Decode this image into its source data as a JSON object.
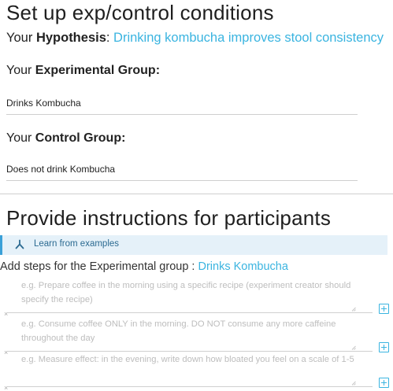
{
  "colors": {
    "accent": "#3ab4e0",
    "learn_bar_bg": "#e5f1f9",
    "learn_bar_border": "#3aa0d8"
  },
  "conditions": {
    "title": "Set up exp/control conditions",
    "hypothesis": {
      "prefix": "Your ",
      "label": "Hypothesis",
      "separator": ": ",
      "value": "Drinking kombucha improves stool consistency"
    },
    "experimental": {
      "prefix": "Your ",
      "label": "Experimental Group:",
      "value": "Drinks Kombucha"
    },
    "control": {
      "prefix": "Your ",
      "label": "Control Group:",
      "value": "Does not drink Kombucha"
    }
  },
  "instructions": {
    "title": "Provide instructions for participants",
    "learn": {
      "icon": "branch-icon",
      "label": "Learn from examples"
    },
    "steps_label": "Add steps for the Experimental group : ",
    "steps_group": "Drinks Kombucha",
    "steps": [
      {
        "placeholder": "e.g. Prepare coffee in the morning using a specific recipe (experiment creator should specify the recipe)",
        "remove_icon": "×",
        "add_icon": "plus-square-icon"
      },
      {
        "placeholder": "e.g. Consume coffee ONLY in the morning. DO NOT consume any more caffeine throughout the day",
        "remove_icon": "×",
        "add_icon": "plus-square-icon"
      },
      {
        "placeholder": "e.g. Measure effect: in the evening, write down how bloated you feel on a scale of 1-5",
        "remove_icon": "×",
        "add_icon": "plus-square-icon"
      }
    ]
  }
}
